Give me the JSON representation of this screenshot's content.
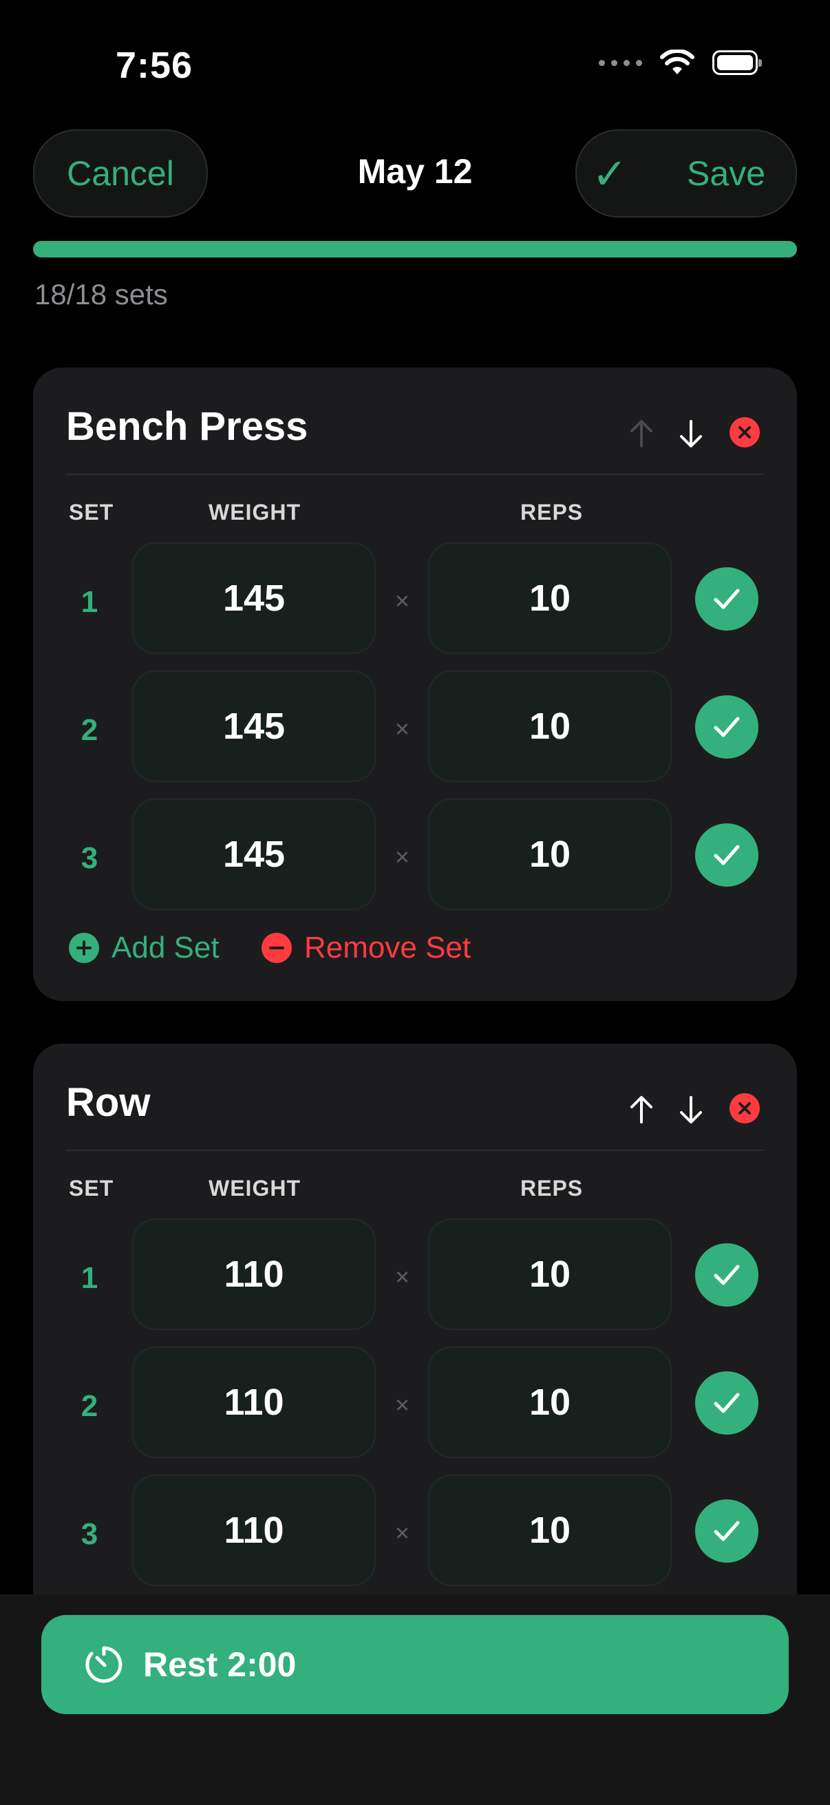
{
  "status_bar": {
    "time": "7:56"
  },
  "header": {
    "cancel_label": "Cancel",
    "title": "May 12",
    "save_label": "Save",
    "save_check": "✓"
  },
  "progress": {
    "label": "18/18 sets",
    "fraction": 1.0
  },
  "columns": {
    "set": "SET",
    "weight": "WEIGHT",
    "reps": "REPS",
    "times": "×"
  },
  "exercises": [
    {
      "name": "Bench Press",
      "move_up_enabled": false,
      "sets": [
        {
          "num": "1",
          "weight": "145",
          "reps": "10",
          "done": true
        },
        {
          "num": "2",
          "weight": "145",
          "reps": "10",
          "done": true
        },
        {
          "num": "3",
          "weight": "145",
          "reps": "10",
          "done": true
        }
      ],
      "add_set_label": "Add Set",
      "remove_set_label": "Remove Set"
    },
    {
      "name": "Row",
      "move_up_enabled": true,
      "sets": [
        {
          "num": "1",
          "weight": "110",
          "reps": "10",
          "done": true
        },
        {
          "num": "2",
          "weight": "110",
          "reps": "10",
          "done": true
        },
        {
          "num": "3",
          "weight": "110",
          "reps": "10",
          "done": true
        }
      ]
    }
  ],
  "rest_button": {
    "label": "Rest 2:00"
  },
  "colors": {
    "accent": "#34b07d",
    "danger": "#ff3b40",
    "background": "#000000",
    "card": "#1c1c1e"
  },
  "icons": [
    "wifi-icon",
    "battery-icon",
    "checkmark-icon",
    "arrow-up-icon",
    "arrow-down-icon",
    "close-icon",
    "plus-circle-icon",
    "minus-circle-icon",
    "timer-icon"
  ]
}
